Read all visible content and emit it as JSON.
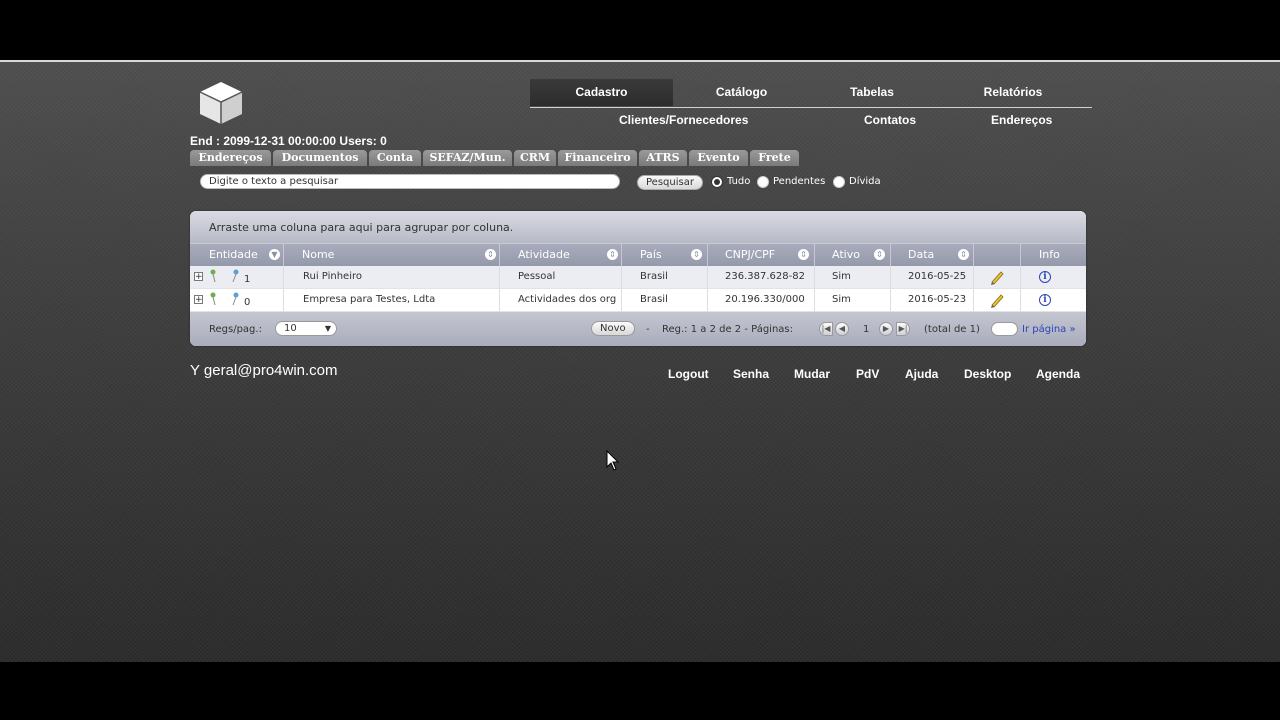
{
  "header": {
    "end_line": "End : 2099-12-31 00:00:00 Users: 0"
  },
  "top_menu": {
    "items": [
      {
        "label": "Cadastro",
        "active": true
      },
      {
        "label": "Catálogo"
      },
      {
        "label": "Tabelas"
      },
      {
        "label": "Relatórios"
      }
    ]
  },
  "sub_menu": {
    "items": [
      {
        "label": "Clientes/Fornecedores"
      },
      {
        "label": "Contatos"
      },
      {
        "label": "Endereços"
      }
    ]
  },
  "tabs": [
    {
      "label": "Endereços"
    },
    {
      "label": "Documentos"
    },
    {
      "label": "Conta"
    },
    {
      "label": "SEFAZ/Mun."
    },
    {
      "label": "CRM"
    },
    {
      "label": "Financeiro"
    },
    {
      "label": "ATRS"
    },
    {
      "label": "Evento"
    },
    {
      "label": "Frete"
    }
  ],
  "search": {
    "placeholder": "Digite o texto a pesquisar",
    "button_label": "Pesquisar",
    "filters": [
      {
        "label": "Tudo",
        "checked": true
      },
      {
        "label": "Pendentes",
        "checked": false
      },
      {
        "label": "Dívida",
        "checked": false
      }
    ]
  },
  "grid": {
    "group_hint": "Arraste uma coluna para aqui para agrupar por coluna.",
    "columns": [
      "Entidade",
      "Nome",
      "Atividade",
      "País",
      "CNPJ/CPF",
      "Ativo",
      "Data",
      "",
      "Info"
    ],
    "rows": [
      {
        "count": "1",
        "nome": "Rui Pinheiro",
        "atividade": "Pessoal",
        "pais": "Brasil",
        "cnpj": "236.387.628-82",
        "ativo": "Sim",
        "data": "2016-05-25"
      },
      {
        "count": "0",
        "nome": "Empresa para Testes, Ldta",
        "atividade": "Actividades dos org",
        "pais": "Brasil",
        "cnpj": "20.196.330/000",
        "ativo": "Sim",
        "data": "2016-05-23"
      }
    ],
    "pager": {
      "regs_label": "Regs/pag.:",
      "regs_value": "10",
      "novo_label": "Novo",
      "dash": "-",
      "reg_info": "Reg.: 1 a 2 de 2 - Páginas:",
      "current_page": "1",
      "total": "(total de 1)",
      "goto_label": "Ir página »"
    }
  },
  "footer": {
    "user_email": "Y geral@pro4win.com",
    "links": [
      "Logout",
      "Senha",
      "Mudar",
      "PdV",
      "Ajuda",
      "Desktop",
      "Agenda"
    ]
  },
  "colors": {
    "background": "#3d3d3d",
    "tab": "#8a8a8a",
    "grid_header": "#9ea2b3",
    "link": "#2a44b8"
  }
}
